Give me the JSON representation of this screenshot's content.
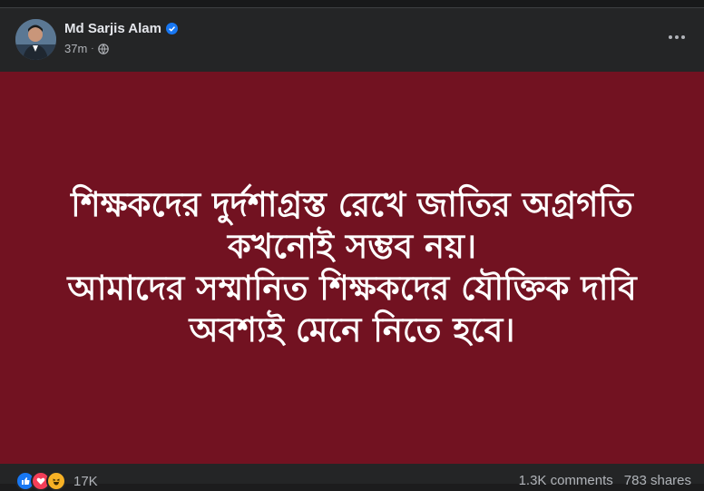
{
  "post": {
    "author": "Md Sarjis Alam",
    "time": "37m",
    "separator": "·",
    "text": "শিক্ষকদের দুর্দশাগ্রস্ত রেখে জাতির অগ্রগতি\nকখনোই সম্ভব নয়।\nআমাদের সম্মানিত শিক্ষকদের যৌক্তিক দাবি\nঅবশ্যই মেনে নিতে হবে।",
    "background_color": "#721221"
  },
  "footer": {
    "reaction_count": "17K",
    "comments": "1.3K comments",
    "shares": "783 shares",
    "reaction_icons": [
      "like-icon",
      "love-icon",
      "haha-icon"
    ]
  }
}
